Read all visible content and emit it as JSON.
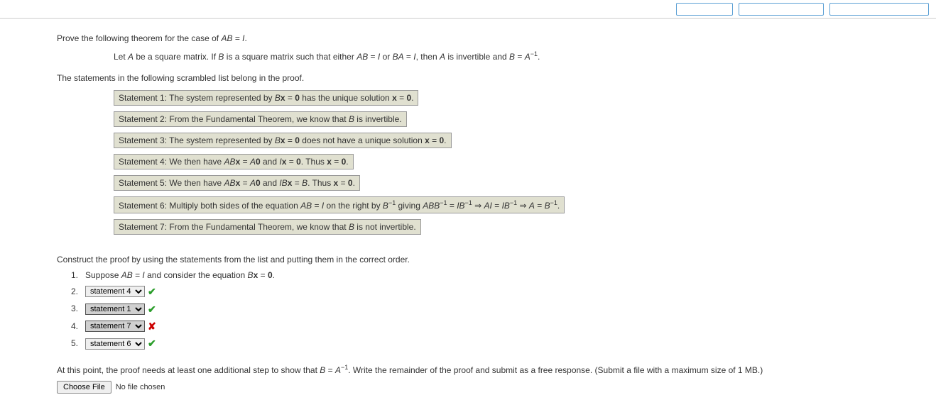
{
  "prompt": "Prove the following theorem for the case of AB = I.",
  "theorem_prefix": "Let A be a square matrix. If B is a square matrix such that either AB = I or BA = I, then A is invertible and B = A",
  "theorem_suffix": ".",
  "scramble_intro": "The statements in the following scrambled list belong in the proof.",
  "statements": [
    "Statement 1: The system represented by Bx = 0 has the unique solution x = 0.",
    "Statement 2: From the Fundamental Theorem, we know that B is invertible.",
    "Statement 3: The system represented by Bx = 0 does not have a unique solution x = 0.",
    "Statement 4: We then have ABx = A0 and Ix = 0. Thus x = 0.",
    "Statement 5: We then have ABx = A0 and IBx = B. Thus x = 0.",
    "Statement 6: Multiply both sides of the equation AB = I on the right by B⁻¹ giving ABB⁻¹ = IB⁻¹ ⇒ AI = IB⁻¹ ⇒ A = B⁻¹.",
    "Statement 7: From the Fundamental Theorem, we know that B is not invertible."
  ],
  "construct_intro": "Construct the proof by using the statements from the list and putting them in the correct order.",
  "proof": {
    "step1_num": "1.",
    "step1_text": "Suppose AB = I and consider the equation Bx = 0.",
    "step2_num": "2.",
    "step2_select": "statement 4",
    "step2_result": "correct",
    "step3_num": "3.",
    "step3_select": "statement 1",
    "step3_result": "correct",
    "step4_num": "4.",
    "step4_select": "statement 7",
    "step4_result": "incorrect",
    "step5_num": "5.",
    "step5_select": "statement 6",
    "step5_result": "correct"
  },
  "free_response_prefix": "At this point, the proof needs at least one additional step to show that B = A",
  "free_response_suffix": ". Write the remainder of the proof and submit as a free response. (Submit a file with a maximum size of 1 MB.)",
  "choose_file_label": "Choose File",
  "no_file_text": "No file chosen",
  "icons": {
    "check": "✔",
    "cross": "✘"
  }
}
